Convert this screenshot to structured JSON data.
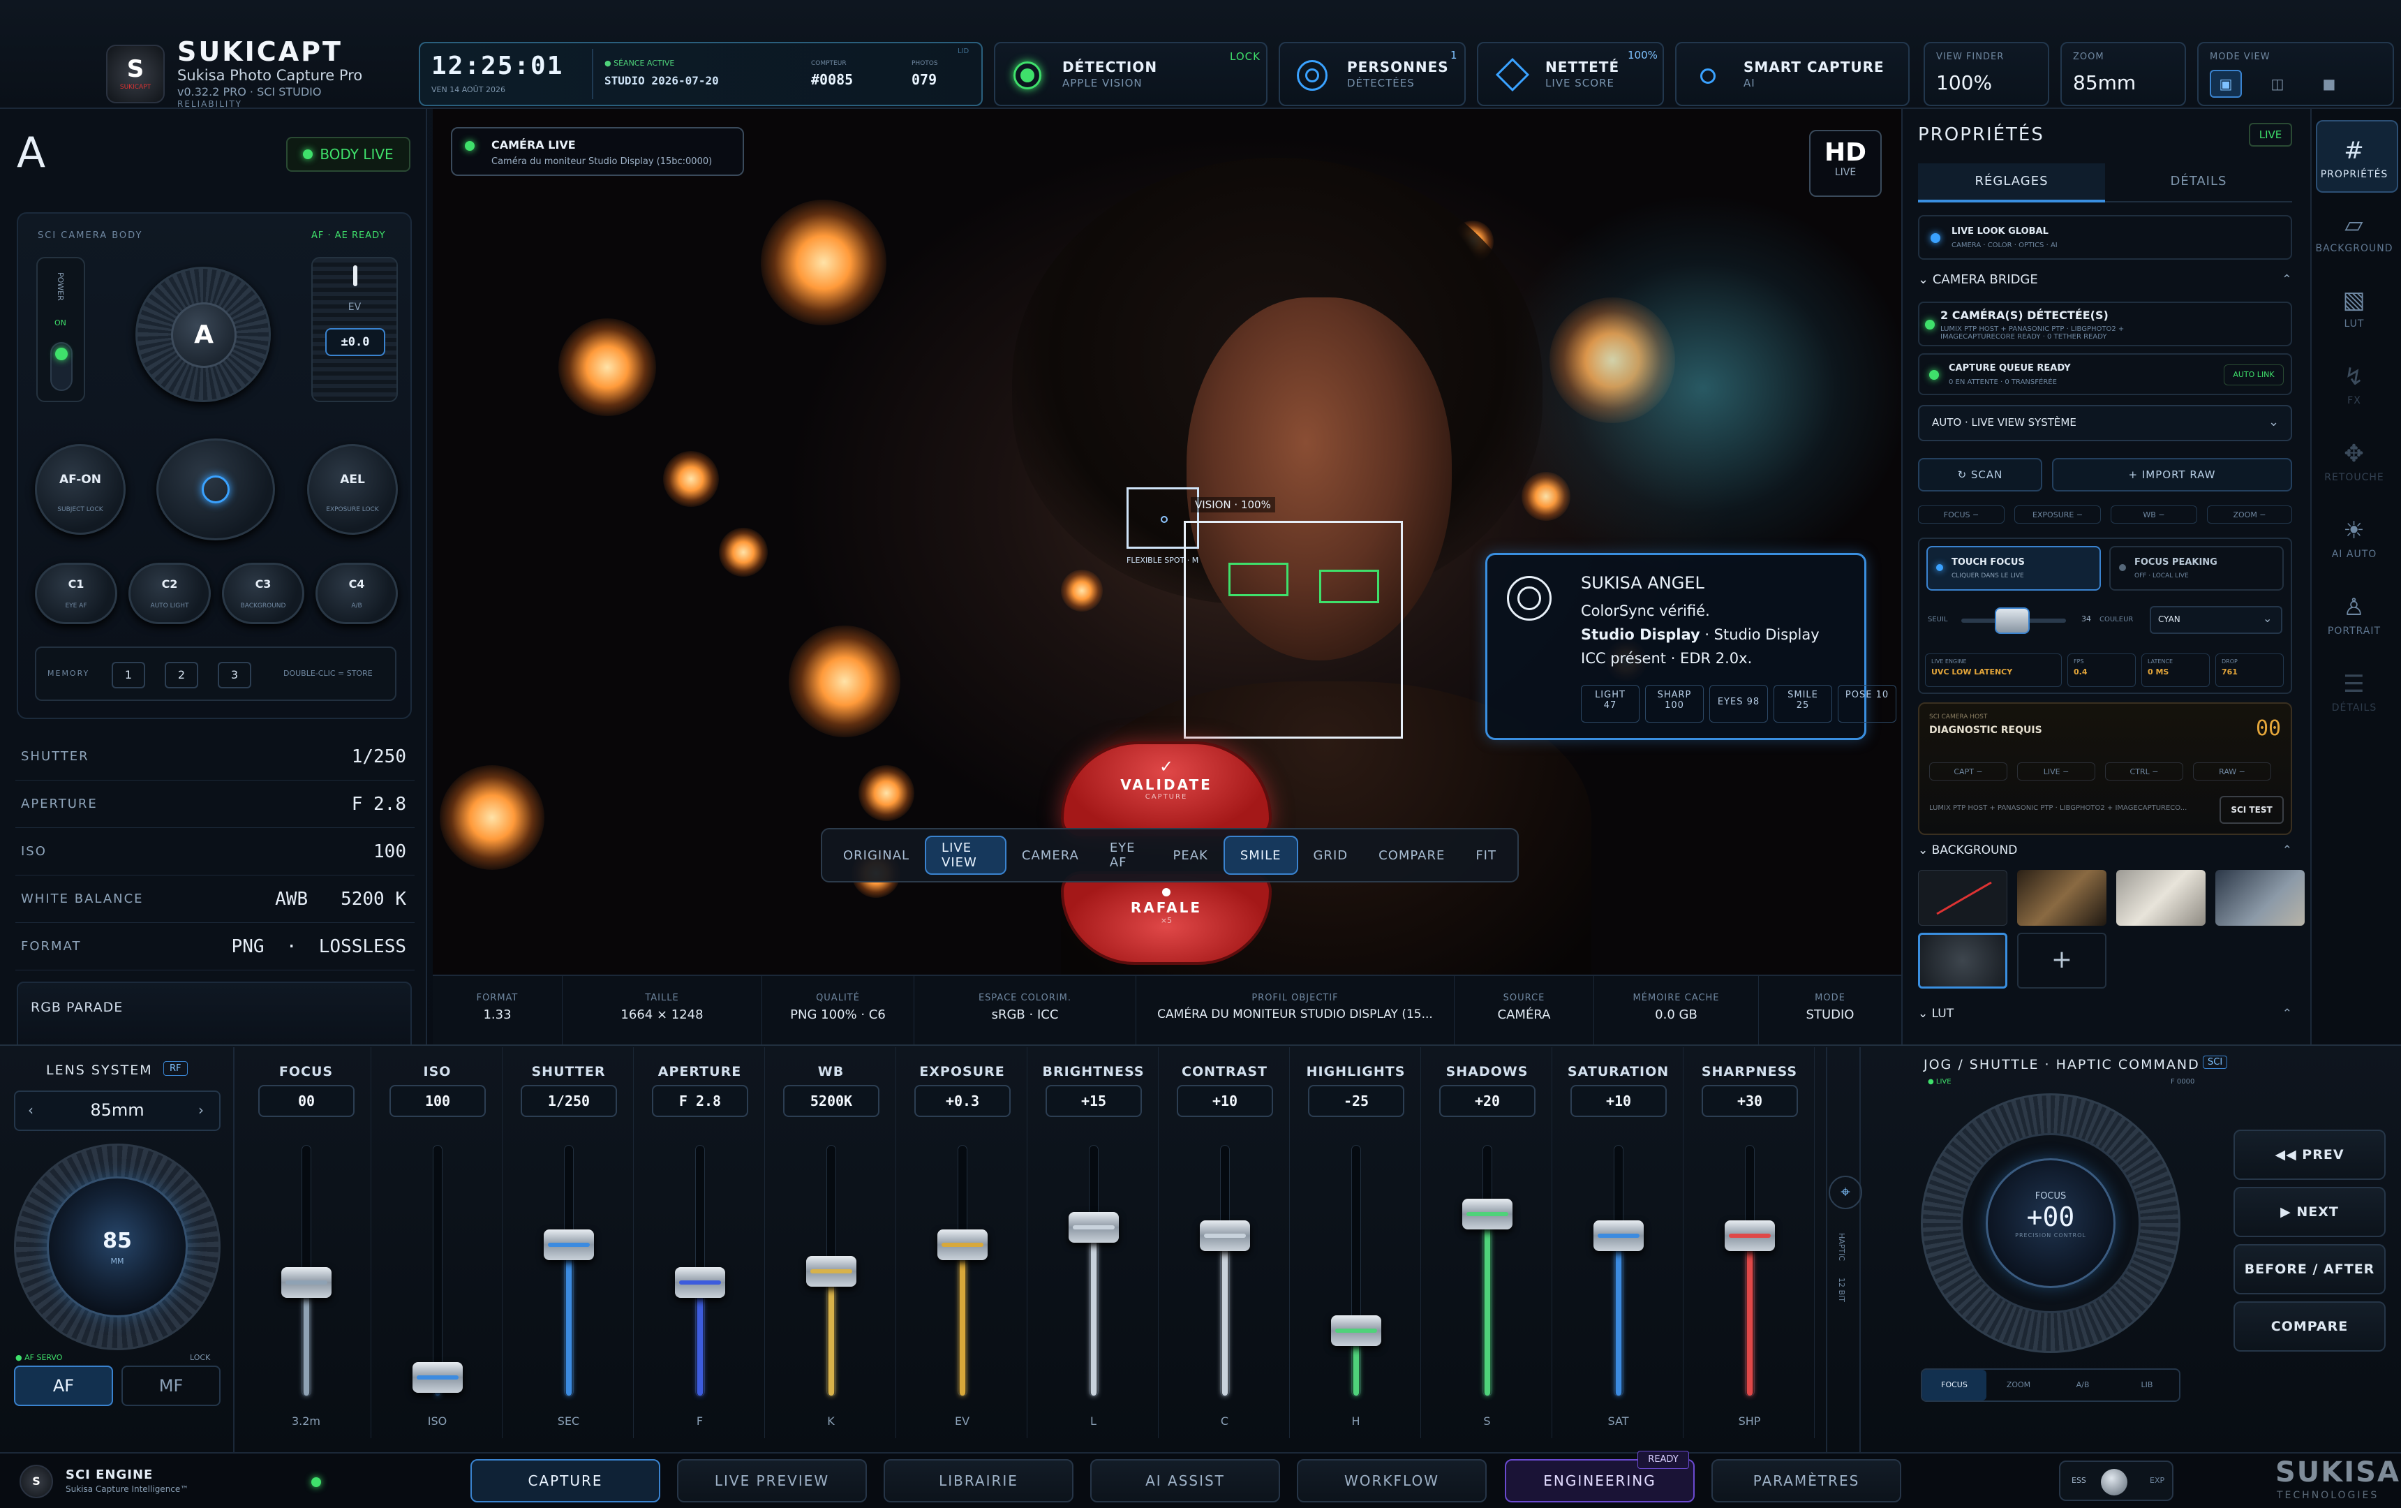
{
  "brand": {
    "name": "SUKICAPT",
    "subtitle": "Sukisa Photo Capture Pro",
    "version": "v0.32.2 PRO · SCI STUDIO",
    "reliability": "RELIABILITY",
    "logo_text": "SUKICAPT"
  },
  "clock": {
    "time": "12:25:01",
    "date": "VEN 14 AOÛT 2026",
    "session_label": "SÉANCE ACTIVE",
    "session": "STUDIO 2026-07-20",
    "counter_label": "COMPTEUR",
    "counter": "#0085",
    "photos_label": "PHOTOS",
    "photos": "079",
    "corner": "LID"
  },
  "status": {
    "detection": {
      "title": "DÉTECTION",
      "sub": "APPLE VISION",
      "badge": "LOCK"
    },
    "persons": {
      "title": "PERSONNES",
      "sub": "DÉTECTÉES",
      "count": "1"
    },
    "sharpness": {
      "title": "NETTETÉ",
      "sub": "LIVE SCORE",
      "value": "100%"
    },
    "smart": {
      "title": "SMART CAPTURE",
      "sub": "AI"
    },
    "viewfinder": {
      "label": "VIEW FINDER",
      "value": "100%"
    },
    "zoom": {
      "label": "ZOOM",
      "value": "85mm"
    },
    "mode_view": {
      "label": "MODE VIEW"
    }
  },
  "left": {
    "mode_letter": "A",
    "body_live": "BODY LIVE",
    "camera_body_label": "SCI CAMERA BODY",
    "af_ready": "AF · AE READY",
    "power": "POWER",
    "on": "ON",
    "dial_letter": "A",
    "ev_label": "EV",
    "ev_value": "±0.0",
    "afon": "AF-ON",
    "afon_sub": "SUBJECT LOCK",
    "ael": "AEL",
    "ael_sub": "EXPOSURE LOCK",
    "customs": [
      {
        "l": "C1",
        "s": "EYE AF"
      },
      {
        "l": "C2",
        "s": "AUTO LIGHT"
      },
      {
        "l": "C3",
        "s": "BACKGROUND"
      },
      {
        "l": "C4",
        "s": "A/B"
      }
    ],
    "memory_label": "MEMORY",
    "memory": [
      "1",
      "2",
      "3"
    ],
    "memory_hint": "DOUBLE-CLIC = STORE",
    "settings": [
      {
        "k": "SHUTTER",
        "v": "1/250"
      },
      {
        "k": "APERTURE",
        "v": "F 2.8"
      },
      {
        "k": "ISO",
        "v": "100"
      },
      {
        "k": "WHITE BALANCE",
        "v": "AWB   5200 K"
      },
      {
        "k": "FORMAT",
        "v": "PNG  ·  LOSSLESS"
      }
    ],
    "rgb_parade": "RGB PARADE"
  },
  "viewer": {
    "camera_live": "CAMÉRA LIVE",
    "camera_desc": "Caméra du moniteur Studio Display (15bc:0000)",
    "hd": "HD",
    "hd_sub": "LIVE",
    "vision": "VISION · 100%",
    "flexible": "FLEXIBLE SPOT · M",
    "card": {
      "title": "SUKISA ANGEL",
      "line1": "ColorSync vérifié.",
      "line2_bold": "Studio Display",
      "line2_rest": " · Studio Display",
      "line3": "ICC présent · EDR 2.0x.",
      "scores": [
        {
          "k": "LIGHT",
          "v": "47"
        },
        {
          "k": "SHARP",
          "v": "100"
        },
        {
          "k": "EYES",
          "v": "98"
        },
        {
          "k": "SMILE",
          "v": "25"
        },
        {
          "k": "POSE",
          "v": "10"
        }
      ]
    },
    "validate": "VALIDATE",
    "validate_sub": "CAPTURE",
    "burst": "RAFALE",
    "burst_sub": "×5",
    "chips": [
      "ORIGINAL",
      "LIVE VIEW",
      "CAMERA",
      "EYE AF",
      "PEAK",
      "SMILE",
      "GRID",
      "COMPARE",
      "FIT"
    ]
  },
  "info": [
    {
      "k": "FORMAT",
      "v": "1.33"
    },
    {
      "k": "TAILLE",
      "v": "1664 × 1248"
    },
    {
      "k": "QUALITÉ",
      "v": "PNG 100% · C6"
    },
    {
      "k": "ESPACE COLORIM.",
      "v": "sRGB · ICC"
    },
    {
      "k": "PROFIL OBJECTIF",
      "v": "CAMÉRA DU MONITEUR STUDIO DISPLAY (15..."
    },
    {
      "k": "SOURCE",
      "v": "CAMÉRA"
    },
    {
      "k": "MÉMOIRE CACHE",
      "v": "0.0 GB"
    },
    {
      "k": "MODE",
      "v": "STUDIO"
    }
  ],
  "props": {
    "title": "PROPRIÉTÉS",
    "live": "LIVE",
    "tab1": "RÉGLAGES",
    "tab2": "DÉTAILS",
    "global": "LIVE LOOK GLOBAL",
    "global_sub": "CAMERA · COLOR · OPTICS · AI",
    "bridge": "CAMERA BRIDGE",
    "detected": "2 CAMÉRA(S) DÉTECTÉE(S)",
    "detected_sub": "LUMIX PTP HOST + PANASONIC PTP · LIBGPHOTO2 + IMAGECAPTURECORE READY · 0 TETHER READY",
    "queue": "CAPTURE QUEUE READY",
    "queue_sub": "0 EN ATTENTE · 0 TRANSFÉRÉE",
    "autolink": "AUTO LINK",
    "select": "AUTO · LIVE VIEW SYSTÈME",
    "scan": "↻ SCAN",
    "import": "+ IMPORT RAW",
    "minis": [
      "FOCUS −",
      "EXPOSURE −",
      "WB −",
      "ZOOM −"
    ],
    "touch": "TOUCH FOCUS",
    "touch_sub": "CLIQUER DANS LE LIVE",
    "peaking": "FOCUS PEAKING",
    "peaking_sub": "OFF · LOCAL LIVE",
    "seuil": "SEUIL",
    "seuil_val": "34",
    "couleur": "COULEUR",
    "color_sel": "CYAN",
    "engine_label": "LIVE ENGINE",
    "engine": "UVC LOW LATENCY",
    "fps_label": "FPS",
    "fps": "0.4",
    "lat_label": "LATENCE",
    "lat": "0 MS",
    "drop_label": "DROP",
    "drop": "761",
    "host_label": "SCI CAMERA HOST",
    "host": "DIAGNOSTIC REQUIS",
    "host_num": "00",
    "host_minis": [
      "CAPT −",
      "LIVE −",
      "CTRL −",
      "RAW −"
    ],
    "host_desc": "LUMIX PTP HOST + PANASONIC PTP · LIBGPHOTO2 + IMAGECAPTURECO...",
    "sci_test": "SCI TEST",
    "background": "BACKGROUND",
    "lut": "LUT",
    "add": "+"
  },
  "side_icons": [
    {
      "icon": "#",
      "label": "PROPRIÉTÉS"
    },
    {
      "icon": "▱",
      "label": "BACKGROUND"
    },
    {
      "icon": "▧",
      "label": "LUT"
    },
    {
      "icon": "↯",
      "label": "FX"
    },
    {
      "icon": "✥",
      "label": "RETOUCHE"
    },
    {
      "icon": "☀",
      "label": "AI AUTO"
    },
    {
      "icon": "♙",
      "label": "PORTRAIT"
    },
    {
      "icon": "☰",
      "label": "DÉTAILS"
    }
  ],
  "lens": {
    "title": "LENS SYSTEM",
    "rf": "RF",
    "focal": "85mm",
    "dial_value": "85",
    "dial_unit": "MM",
    "af_servo": "AF SERVO",
    "lock": "LOCK",
    "af": "AF",
    "mf": "MF"
  },
  "faders": [
    {
      "name": "FOCUS",
      "value": "00",
      "unit": "3.2m",
      "level": 0.45,
      "color": "#8fa2b4"
    },
    {
      "name": "ISO",
      "value": "100",
      "unit": "ISO",
      "level": 0.02,
      "color": "#3c8be0"
    },
    {
      "name": "SHUTTER",
      "value": "1/250",
      "unit": "SEC",
      "level": 0.62,
      "color": "#3c8be0"
    },
    {
      "name": "APERTURE",
      "value": "F 2.8",
      "unit": "F",
      "level": 0.45,
      "color": "#3d5cdd"
    },
    {
      "name": "WB",
      "value": "5200K",
      "unit": "K",
      "level": 0.5,
      "color": "#d8b24a"
    },
    {
      "name": "EXPOSURE",
      "value": "+0.3",
      "unit": "EV",
      "level": 0.62,
      "color": "#d8a83a"
    },
    {
      "name": "BRIGHTNESS",
      "value": "+15",
      "unit": "L",
      "level": 0.7,
      "color": "#c8d2dc"
    },
    {
      "name": "CONTRAST",
      "value": "+10",
      "unit": "C",
      "level": 0.66,
      "color": "#c8d2dc"
    },
    {
      "name": "HIGHLIGHTS",
      "value": "-25",
      "unit": "H",
      "level": 0.23,
      "color": "#4fd27a"
    },
    {
      "name": "SHADOWS",
      "value": "+20",
      "unit": "S",
      "level": 0.76,
      "color": "#4fd27a"
    },
    {
      "name": "SATURATION",
      "value": "+10",
      "unit": "SAT",
      "level": 0.66,
      "color": "#3c8be0"
    },
    {
      "name": "SHARPNESS",
      "value": "+30",
      "unit": "SHP",
      "level": 0.66,
      "color": "#e04848"
    }
  ],
  "jog": {
    "title": "JOG / SHUTTLE · HAPTIC COMMAND",
    "sci": "SCI",
    "live": "LIVE",
    "f_label": "F 0000",
    "focus": "FOCUS",
    "value": "+00",
    "precision": "PRECISION CONTROL",
    "haptic": "HAPTIC",
    "bit": "12 BIT",
    "modes": [
      "FOCUS",
      "ZOOM",
      "A/B",
      "LIB"
    ],
    "buttons": [
      "◀◀ PREV",
      "▶ NEXT",
      "BEFORE / AFTER",
      "COMPARE"
    ]
  },
  "footer": {
    "engine": "SCI ENGINE",
    "engine_sub": "Sukisa Capture Intelligence™",
    "tabs": [
      "CAPTURE",
      "LIVE PREVIEW",
      "LIBRAIRIE",
      "AI ASSIST",
      "WORKFLOW",
      "ENGINEERING",
      "PARAMÈTRES"
    ],
    "ready": "READY",
    "ess": "ESS",
    "exp": "EXP",
    "brand": "SUKISA",
    "brand_sub": "TECHNOLOGIES"
  }
}
